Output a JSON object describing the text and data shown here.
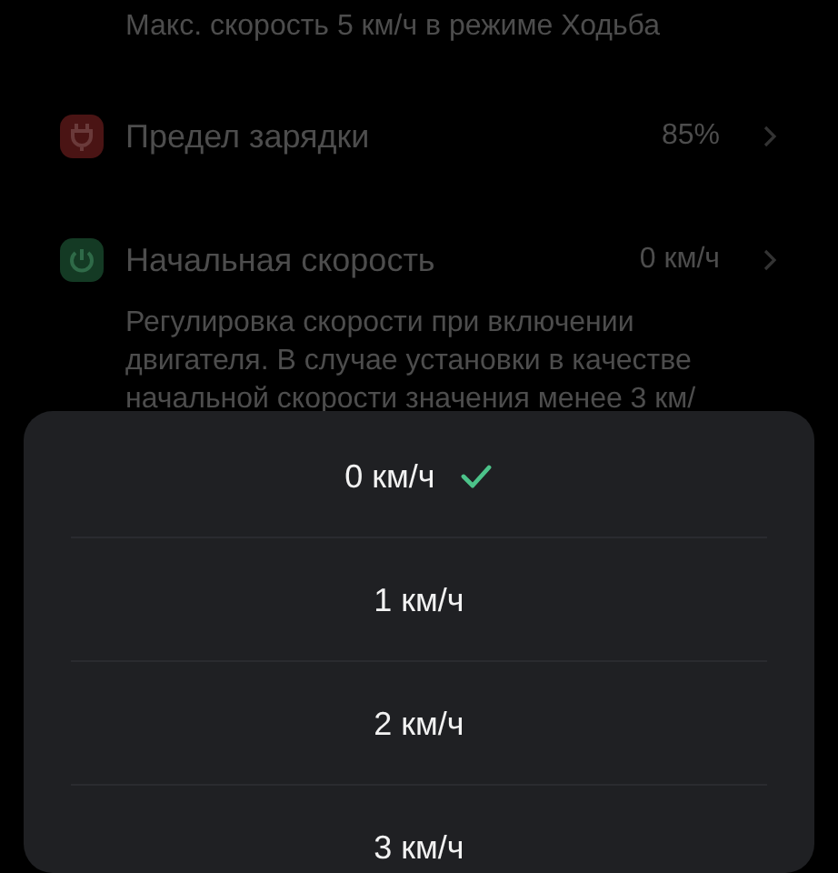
{
  "settings": {
    "note": "Макс. скорость 5 км/ч в режиме Ходьба",
    "rows": [
      {
        "kind": "charge",
        "label": "Предел зарядки",
        "value": "85%"
      },
      {
        "kind": "power",
        "label": "Начальная скорость",
        "value": "0 км/ч"
      }
    ],
    "description": "Регулировка скорости при включении двигателя. В случае установки в качестве начальной скорости значения менее 3 км/"
  },
  "picker": {
    "options": [
      {
        "label": "0 км/ч",
        "selected": true
      },
      {
        "label": "1 км/ч",
        "selected": false
      },
      {
        "label": "2 км/ч",
        "selected": false
      },
      {
        "label": "3 км/ч",
        "selected": false
      }
    ]
  }
}
